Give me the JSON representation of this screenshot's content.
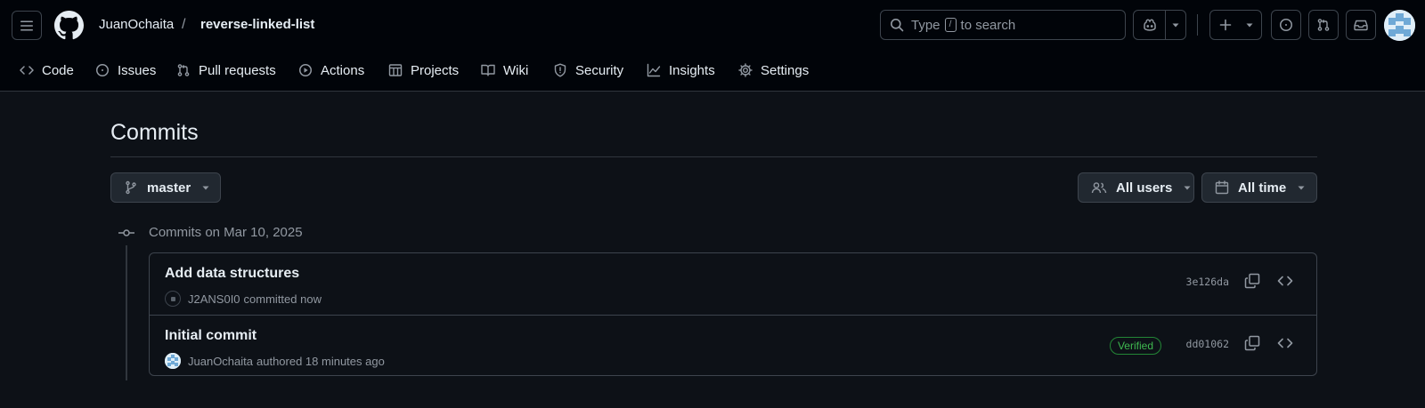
{
  "header": {
    "owner": "JuanOchaita",
    "separator": "/",
    "repo": "reverse-linked-list",
    "search": {
      "prefix": "Type",
      "key": "/",
      "suffix": "to search"
    },
    "icons": [
      "menu-icon",
      "github-logo-icon",
      "copilot-icon",
      "plus-icon",
      "issues-icon",
      "pull-request-icon",
      "inbox-icon"
    ]
  },
  "nav": {
    "tabs": [
      {
        "label": "Code",
        "icon": "code-icon"
      },
      {
        "label": "Issues",
        "icon": "issue-icon"
      },
      {
        "label": "Pull requests",
        "icon": "pull-request-icon"
      },
      {
        "label": "Actions",
        "icon": "play-icon"
      },
      {
        "label": "Projects",
        "icon": "table-icon"
      },
      {
        "label": "Wiki",
        "icon": "book-icon"
      },
      {
        "label": "Security",
        "icon": "shield-icon"
      },
      {
        "label": "Insights",
        "icon": "graph-icon"
      },
      {
        "label": "Settings",
        "icon": "gear-icon"
      }
    ]
  },
  "main": {
    "title": "Commits",
    "branch": "master",
    "users_filter": "All users",
    "time_filter": "All time",
    "group_heading": "Commits on Mar 10, 2025",
    "commits": [
      {
        "title": "Add data structures",
        "author": "J2ANS0I0",
        "action": "committed now",
        "verified": "",
        "sha": "3e126da"
      },
      {
        "title": "Initial commit",
        "author": "JuanOchaita",
        "action": "authored 18 minutes ago",
        "verified": "Verified",
        "sha": "dd01062"
      }
    ]
  },
  "colors": {
    "background": "#0d1117",
    "header_background": "#010409",
    "border": "#3d444d",
    "text": "#e6edf3",
    "muted": "#9198a1",
    "verified_green": "#3fb950"
  }
}
